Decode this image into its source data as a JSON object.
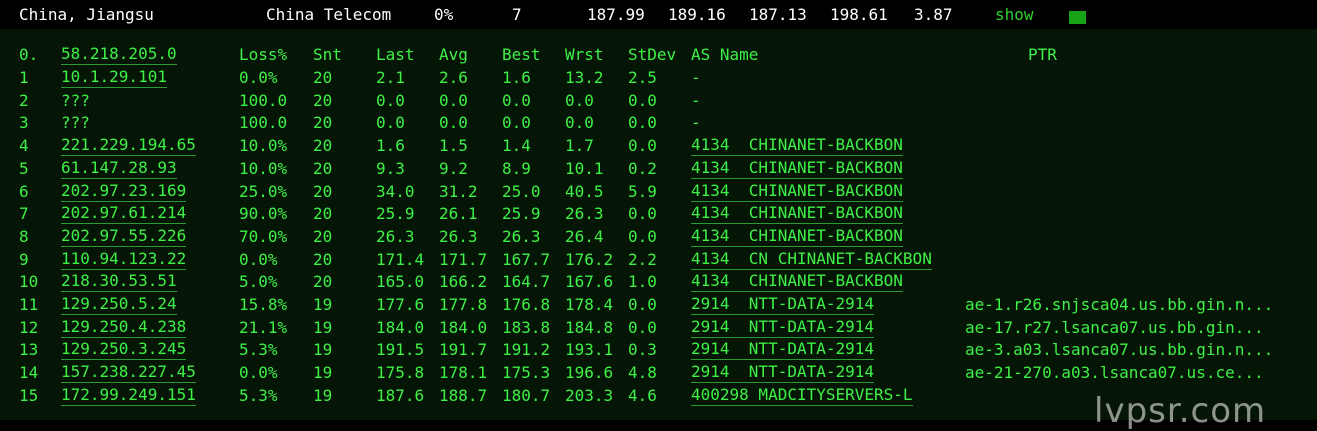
{
  "summary": {
    "location": "China, Jiangsu",
    "isp": "China Telecom",
    "loss": "0%",
    "snt": "7",
    "last": "187.99",
    "avg": "189.16",
    "best": "187.13",
    "wrst": "198.61",
    "stdev": "3.87",
    "show_label": "show",
    "status_color": "#16a416"
  },
  "header": {
    "index": "0.",
    "host": "58.218.205.0",
    "loss": "Loss%",
    "snt": "Snt",
    "last": "Last",
    "avg": "Avg",
    "best": "Best",
    "wrst": "Wrst",
    "stdev": "StDev",
    "asname": "AS Name",
    "ptr": "PTR"
  },
  "hops": [
    {
      "n": "1",
      "host": "10.1.29.101",
      "loss": "0.0%",
      "snt": "20",
      "last": "2.1",
      "avg": "2.6",
      "best": "1.6",
      "wrst": "13.2",
      "stdev": "2.5",
      "as": "-",
      "ptr": ""
    },
    {
      "n": "2",
      "host": "???",
      "loss": "100.0",
      "snt": "20",
      "last": "0.0",
      "avg": "0.0",
      "best": "0.0",
      "wrst": "0.0",
      "stdev": "0.0",
      "as": "-",
      "ptr": ""
    },
    {
      "n": "3",
      "host": "???",
      "loss": "100.0",
      "snt": "20",
      "last": "0.0",
      "avg": "0.0",
      "best": "0.0",
      "wrst": "0.0",
      "stdev": "0.0",
      "as": "-",
      "ptr": ""
    },
    {
      "n": "4",
      "host": "221.229.194.65",
      "loss": "10.0%",
      "snt": "20",
      "last": "1.6",
      "avg": "1.5",
      "best": "1.4",
      "wrst": "1.7",
      "stdev": "0.0",
      "as": "4134  CHINANET-BACKBON",
      "ptr": ""
    },
    {
      "n": "5",
      "host": "61.147.28.93",
      "loss": "10.0%",
      "snt": "20",
      "last": "9.3",
      "avg": "9.2",
      "best": "8.9",
      "wrst": "10.1",
      "stdev": "0.2",
      "as": "4134  CHINANET-BACKBON",
      "ptr": ""
    },
    {
      "n": "6",
      "host": "202.97.23.169",
      "loss": "25.0%",
      "snt": "20",
      "last": "34.0",
      "avg": "31.2",
      "best": "25.0",
      "wrst": "40.5",
      "stdev": "5.9",
      "as": "4134  CHINANET-BACKBON",
      "ptr": ""
    },
    {
      "n": "7",
      "host": "202.97.61.214",
      "loss": "90.0%",
      "snt": "20",
      "last": "25.9",
      "avg": "26.1",
      "best": "25.9",
      "wrst": "26.3",
      "stdev": "0.0",
      "as": "4134  CHINANET-BACKBON",
      "ptr": ""
    },
    {
      "n": "8",
      "host": "202.97.55.226",
      "loss": "70.0%",
      "snt": "20",
      "last": "26.3",
      "avg": "26.3",
      "best": "26.3",
      "wrst": "26.4",
      "stdev": "0.0",
      "as": "4134  CHINANET-BACKBON",
      "ptr": ""
    },
    {
      "n": "9",
      "host": "110.94.123.22",
      "loss": "0.0%",
      "snt": "20",
      "last": "171.4",
      "avg": "171.7",
      "best": "167.7",
      "wrst": "176.2",
      "stdev": "2.2",
      "as": "4134  CN CHINANET-BACKBON",
      "ptr": ""
    },
    {
      "n": "10",
      "host": "218.30.53.51",
      "loss": "5.0%",
      "snt": "20",
      "last": "165.0",
      "avg": "166.2",
      "best": "164.7",
      "wrst": "167.6",
      "stdev": "1.0",
      "as": "4134  CHINANET-BACKBON",
      "ptr": ""
    },
    {
      "n": "11",
      "host": "129.250.5.24",
      "loss": "15.8%",
      "snt": "19",
      "last": "177.6",
      "avg": "177.8",
      "best": "176.8",
      "wrst": "178.4",
      "stdev": "0.0",
      "as": "2914  NTT-DATA-2914",
      "ptr": "ae-1.r26.snjsca04.us.bb.gin.n..."
    },
    {
      "n": "12",
      "host": "129.250.4.238",
      "loss": "21.1%",
      "snt": "19",
      "last": "184.0",
      "avg": "184.0",
      "best": "183.8",
      "wrst": "184.8",
      "stdev": "0.0",
      "as": "2914  NTT-DATA-2914",
      "ptr": "ae-17.r27.lsanca07.us.bb.gin..."
    },
    {
      "n": "13",
      "host": "129.250.3.245",
      "loss": "5.3%",
      "snt": "19",
      "last": "191.5",
      "avg": "191.7",
      "best": "191.2",
      "wrst": "193.1",
      "stdev": "0.3",
      "as": "2914  NTT-DATA-2914",
      "ptr": "ae-3.a03.lsanca07.us.bb.gin.n..."
    },
    {
      "n": "14",
      "host": "157.238.227.45",
      "loss": "0.0%",
      "snt": "19",
      "last": "175.8",
      "avg": "178.1",
      "best": "175.3",
      "wrst": "196.6",
      "stdev": "4.8",
      "as": "2914  NTT-DATA-2914",
      "ptr": "ae-21-270.a03.lsanca07.us.ce..."
    },
    {
      "n": "15",
      "host": "172.99.249.151",
      "loss": "5.3%",
      "snt": "19",
      "last": "187.6",
      "avg": "188.7",
      "best": "180.7",
      "wrst": "203.3",
      "stdev": "4.6",
      "as": "400298 MADCITYSERVERS-L",
      "ptr": ""
    }
  ],
  "watermark": "lvpsr.com"
}
